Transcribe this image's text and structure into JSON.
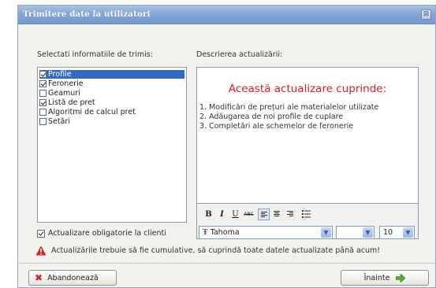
{
  "window": {
    "title": "Trimitere date la utilizatori",
    "close_glyph": "⊠"
  },
  "left_panel": {
    "label": "Selectati informatiile de trimis:",
    "items": [
      {
        "label": "Profile",
        "checked": true,
        "selected": true
      },
      {
        "label": "Feronerie",
        "checked": true,
        "selected": false
      },
      {
        "label": "Geamuri",
        "checked": false,
        "selected": false
      },
      {
        "label": "Listă de pret",
        "checked": true,
        "selected": false
      },
      {
        "label": "Algoritmi de calcul pret",
        "checked": false,
        "selected": false
      },
      {
        "label": "Setări",
        "checked": false,
        "selected": false
      }
    ]
  },
  "right_panel": {
    "label": "Descrierea actualizării:",
    "heading": "Această actualizare cuprinde:",
    "lines": [
      "1. Modificări de prețuri ale materialelor utilizate",
      "2. Adăugarea de noi profile de cuplare",
      "3. Completări ale schemelor de feronerie"
    ]
  },
  "format_toolbar": {
    "bold": "B",
    "italic": "I",
    "underline": "U",
    "strike": "ABC",
    "font_glyph": "Ŧ",
    "font_name": "Tahoma",
    "size_value": "",
    "font_size": "10",
    "dropdown_glyph": "▼"
  },
  "mandatory_checkbox": {
    "label": "Actualizare obligatorie la clienti",
    "checked": true
  },
  "warning": {
    "text": "Actualizările trebuie să fie cumulative, să cuprindă toate datele actualizate până acum!"
  },
  "buttons": {
    "cancel": "Abandonează",
    "next": "Înainte",
    "cancel_glyph": "✖"
  },
  "colors": {
    "accent": "#316ac5",
    "heading_red": "#d32020",
    "title_bar": "#84a7d8",
    "next_arrow_green": "#4caf28",
    "warning_red": "#d22222"
  }
}
